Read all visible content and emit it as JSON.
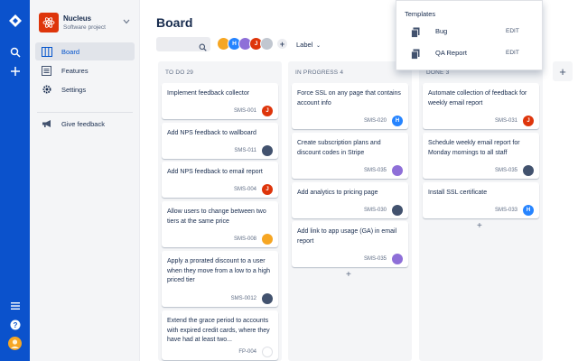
{
  "colors": {
    "rail": "#0b52cc",
    "project_avatar": "#de350b",
    "accent": "#0052cc"
  },
  "rail": {
    "icons": [
      "jira-logo-icon",
      "search-icon",
      "create-plus-icon",
      "menu-icon",
      "help-icon",
      "user-avatar-icon"
    ]
  },
  "project": {
    "name": "Nucleus",
    "type": "Software project"
  },
  "sidebar": {
    "items": [
      {
        "label": "Board",
        "icon": "board-icon",
        "active": true
      },
      {
        "label": "Features",
        "icon": "features-icon",
        "active": false
      },
      {
        "label": "Settings",
        "icon": "settings-icon",
        "active": false
      },
      {
        "label": "Give feedback",
        "icon": "megaphone-icon",
        "active": false
      }
    ]
  },
  "board": {
    "title": "Board",
    "filter_label": "Label",
    "avatars": [
      {
        "initial": "",
        "color": "#f6a623"
      },
      {
        "initial": "H",
        "color": "#2684ff"
      },
      {
        "initial": "",
        "color": "#8e6fd8"
      },
      {
        "initial": "J",
        "color": "#de350b"
      },
      {
        "initial": "",
        "color": "#c1c7d0"
      }
    ],
    "columns": [
      {
        "header": "TO DO",
        "count": "29",
        "cards": [
          {
            "text": "Implement feedback collector",
            "key": "SMS-001",
            "avatar": "J",
            "avatar_color": "#de350b"
          },
          {
            "text": "Add NPS feedback to wallboard",
            "key": "SMS-011",
            "avatar": "",
            "avatar_color": "#42526e"
          },
          {
            "text": "Add NPS feedback to email report",
            "key": "SMS-004",
            "avatar": "J",
            "avatar_color": "#de350b"
          },
          {
            "text": "Allow users to change between two tiers at the same price",
            "key": "SMS-008",
            "avatar": "",
            "avatar_color": "#f6a623"
          },
          {
            "text": "Apply a prorated discount to a user when they move from a low to a high priced tier",
            "key": "SMS-0012",
            "avatar": "",
            "avatar_color": "#42526e"
          },
          {
            "text": "Extend the grace period to accounts with expired credit cards, where they have had at least two...",
            "key": "FP-004",
            "avatar": "",
            "avatar_color": "#ffffff"
          }
        ]
      },
      {
        "header": "IN PROGRESS",
        "count": "4",
        "cards": [
          {
            "text": "Force SSL on any page that contains account info",
            "key": "SMS-020",
            "avatar": "H",
            "avatar_color": "#2684ff"
          },
          {
            "text": "Create subscription plans and discount codes in Stripe",
            "key": "SMS-035",
            "avatar": "",
            "avatar_color": "#8e6fd8"
          },
          {
            "text": "Add analytics to pricing page",
            "key": "SMS-030",
            "avatar": "",
            "avatar_color": "#42526e"
          },
          {
            "text": "Add link to app usage (GA) in email report",
            "key": "SMS-035",
            "avatar": "",
            "avatar_color": "#8e6fd8"
          }
        ]
      },
      {
        "header": "DONE",
        "count": "3",
        "cards": [
          {
            "text": "Automate collection of feedback for weekly email report",
            "key": "SMS-031",
            "avatar": "J",
            "avatar_color": "#de350b"
          },
          {
            "text": "Schedule weekly email report for Monday mornings to all staff",
            "key": "SMS-035",
            "avatar": "",
            "avatar_color": "#42526e"
          },
          {
            "text": "Install SSL certificate",
            "key": "SMS-033",
            "avatar": "H",
            "avatar_color": "#2684ff"
          }
        ]
      }
    ]
  },
  "templates": {
    "title": "Templates",
    "items": [
      {
        "name": "Bug",
        "edit": "EDIT"
      },
      {
        "name": "QA Report",
        "edit": "EDIT"
      }
    ]
  }
}
